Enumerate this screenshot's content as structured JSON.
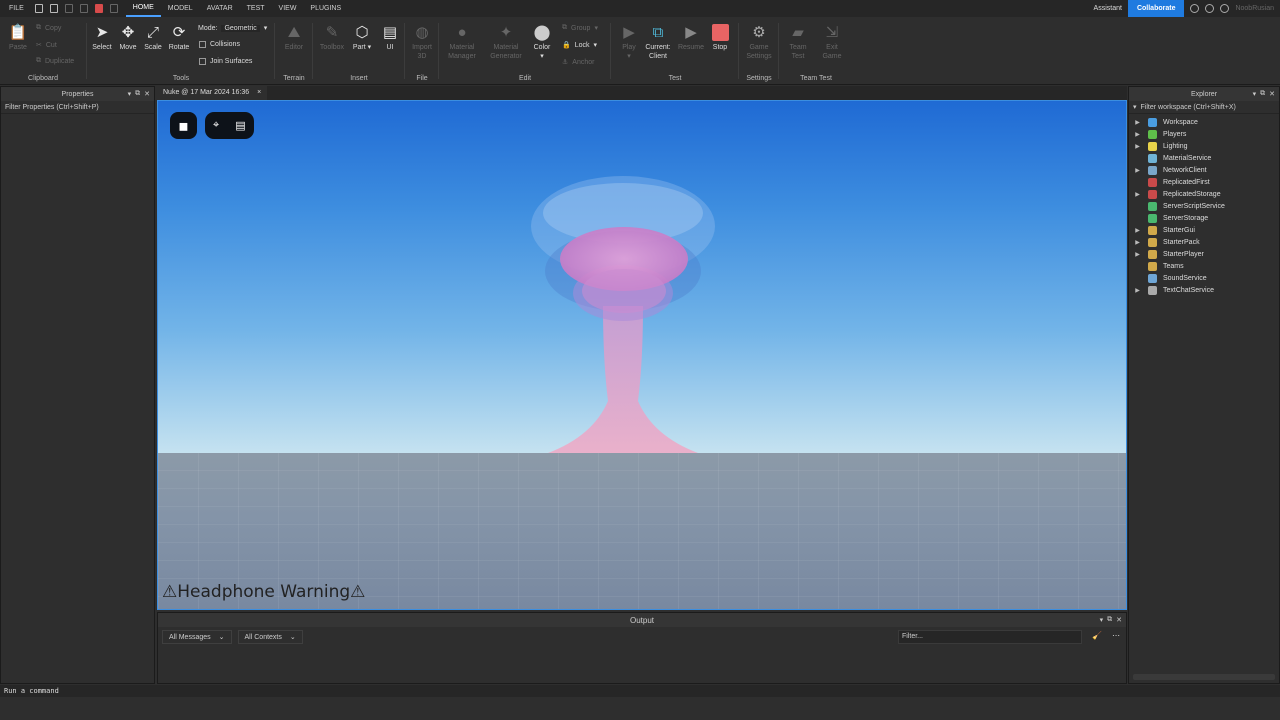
{
  "menu": {
    "file": "FILE",
    "tabs": [
      "HOME",
      "MODEL",
      "AVATAR",
      "TEST",
      "VIEW",
      "PLUGINS"
    ]
  },
  "topbar_right": {
    "assistant": "Assistant",
    "collaborate": "Collaborate",
    "user": "NoobRusian"
  },
  "ribbon": {
    "clipboard": {
      "label": "Clipboard",
      "paste": "Paste",
      "copy": "Copy",
      "cut": "Cut",
      "duplicate": "Duplicate"
    },
    "tools": {
      "label": "Tools",
      "select": "Select",
      "move": "Move",
      "scale": "Scale",
      "rotate": "Rotate",
      "mode_label": "Mode:",
      "mode_value": "Geometric",
      "collisions": "Collisions",
      "join_surfaces": "Join Surfaces"
    },
    "terrain": {
      "label": "Terrain",
      "editor": "Editor"
    },
    "insert": {
      "label": "Insert",
      "toolbox": "Toolbox",
      "part": "Part",
      "ui": "UI"
    },
    "file": {
      "label": "File",
      "import3d_1": "Import",
      "import3d_2": "3D"
    },
    "edit": {
      "label": "Edit",
      "material_manager_1": "Material",
      "material_manager_2": "Manager",
      "material_generator_1": "Material",
      "material_generator_2": "Generator",
      "color": "Color",
      "group": "Group",
      "lock": "Lock",
      "anchor": "Anchor"
    },
    "test": {
      "label": "Test",
      "play": "Play",
      "current_client_1": "Current:",
      "current_client_2": "Client",
      "resume": "Resume",
      "stop": "Stop"
    },
    "settings": {
      "label": "Settings",
      "game_settings_1": "Game",
      "game_settings_2": "Settings"
    },
    "team_test": {
      "label": "Team Test",
      "team_test_1": "Team",
      "team_test_2": "Test",
      "exit_game_1": "Exit",
      "exit_game_2": "Game"
    }
  },
  "properties": {
    "title": "Properties",
    "filter": "Filter Properties (Ctrl+Shift+P)"
  },
  "viewport_tab": {
    "label": "Nuke @ 17 Mar 2024 16:36",
    "close": "×"
  },
  "viewport": {
    "warning": "⚠Headphone Warning⚠"
  },
  "explorer": {
    "title": "Explorer",
    "filter": "Filter workspace (Ctrl+Shift+X)",
    "items": [
      {
        "name": "Workspace",
        "color": "#4a9de0",
        "expandable": true
      },
      {
        "name": "Players",
        "color": "#5fbf4a",
        "expandable": true
      },
      {
        "name": "Lighting",
        "color": "#e8d34a",
        "expandable": true
      },
      {
        "name": "MaterialService",
        "color": "#6fb3d6",
        "expandable": false
      },
      {
        "name": "NetworkClient",
        "color": "#7aa6c9",
        "expandable": true
      },
      {
        "name": "ReplicatedFirst",
        "color": "#c94a4a",
        "expandable": false
      },
      {
        "name": "ReplicatedStorage",
        "color": "#c94a4a",
        "expandable": true
      },
      {
        "name": "ServerScriptService",
        "color": "#4ab86f",
        "expandable": false
      },
      {
        "name": "ServerStorage",
        "color": "#4ab86f",
        "expandable": false
      },
      {
        "name": "StarterGui",
        "color": "#d1a94a",
        "expandable": true
      },
      {
        "name": "StarterPack",
        "color": "#d1a94a",
        "expandable": true
      },
      {
        "name": "StarterPlayer",
        "color": "#d1a94a",
        "expandable": true
      },
      {
        "name": "Teams",
        "color": "#d1a94a",
        "expandable": false
      },
      {
        "name": "SoundService",
        "color": "#6fa6d6",
        "expandable": false
      },
      {
        "name": "TextChatService",
        "color": "#aaaaaa",
        "expandable": true
      }
    ]
  },
  "output": {
    "title": "Output",
    "messages": "All Messages",
    "contexts": "All Contexts",
    "filter": "Filter..."
  },
  "command_bar": {
    "placeholder": "Run a command"
  }
}
